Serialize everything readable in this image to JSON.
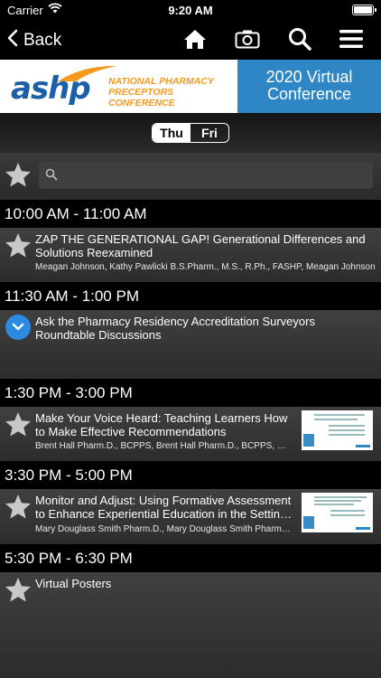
{
  "status_bar": {
    "carrier": "Carrier",
    "time": "9:20 AM"
  },
  "nav": {
    "back_label": "Back"
  },
  "banner": {
    "logo_text": "ashp",
    "conference_line1": "NATIONAL PHARMACY",
    "conference_line2": "PRECEPTORS CONFERENCE",
    "event_line1": "2020 Virtual",
    "event_line2": "Conference"
  },
  "days": {
    "active": "Thu",
    "other": "Fri"
  },
  "search": {
    "placeholder": ""
  },
  "schedule": [
    {
      "time": "10:00 AM - 11:00 AM"
    },
    {
      "time": "11:30 AM - 1:00 PM"
    },
    {
      "time": "1:30 PM - 3:00 PM"
    },
    {
      "time": "3:30 PM - 5:00 PM"
    },
    {
      "time": "5:30 PM - 6:30 PM"
    }
  ],
  "sessions": [
    {
      "title": "ZAP THE GENERATIONAL GAP! Generational Differences and Solutions Reexamined",
      "speakers": "Meagan Johnson, Kathy Pawlicki B.S.Pharm., M.S., R.Ph., FASHP, Meagan Johnson"
    },
    {
      "title": "Ask the Pharmacy Residency Accreditation Surveyors Roundtable Discussions",
      "speakers": ""
    },
    {
      "title": "Make Your Voice Heard: Teaching Learners How to Make Effective Recommendations",
      "speakers": "Brent Hall Pharm.D., BCPPS, Brent Hall Pharm.D., BCPPS, Nic..."
    },
    {
      "title": "Monitor and Adjust: Using Formative Assessment to Enhance Experiential Education in the Settin…",
      "speakers": "Mary Douglass Smith Pharm.D., Mary Douglass Smith Pharm.D.,…"
    },
    {
      "title": "Virtual Posters",
      "speakers": ""
    }
  ],
  "colors": {
    "accent_blue": "#2f86c5",
    "brand_blue": "#1b5fa8",
    "brand_orange": "#f39a1e",
    "expand_blue": "#2b8be0"
  }
}
